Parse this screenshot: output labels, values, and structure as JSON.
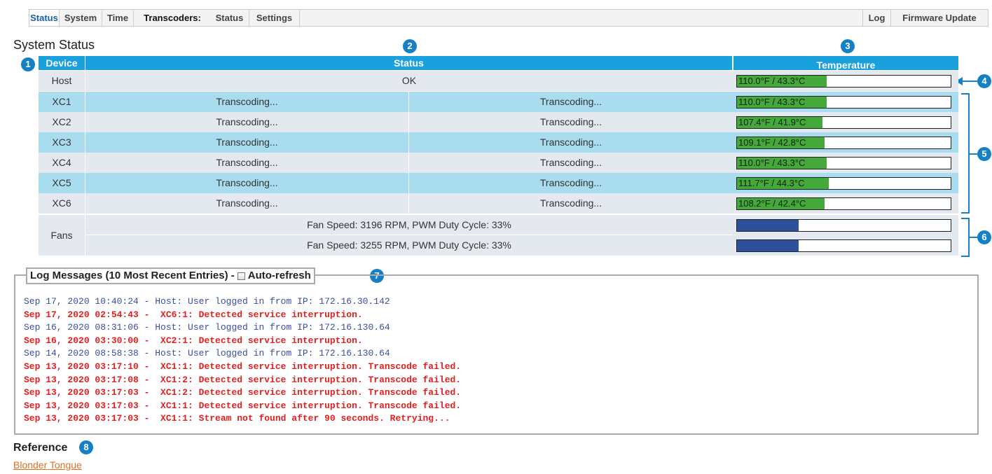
{
  "nav": {
    "items": [
      "Status",
      "System",
      "Time"
    ],
    "section_label": "Transcoders:",
    "sub_items": [
      "Status",
      "Settings"
    ],
    "right_items": [
      "Log",
      "Firmware Update"
    ]
  },
  "title": "System Status",
  "callouts": [
    "1",
    "2",
    "3",
    "4",
    "5",
    "6",
    "7",
    "8"
  ],
  "table": {
    "headers": {
      "device": "Device",
      "status": "Status",
      "temperature": "Temperature"
    },
    "host": {
      "device": "Host",
      "status": "OK",
      "temp": "110.0°F / 43.3°C",
      "temp_fraction": 0.42
    },
    "transcoders": [
      {
        "device": "XC1",
        "status_a": "Transcoding...",
        "status_b": "Transcoding...",
        "temp": "110.0°F / 43.3°C",
        "temp_fraction": 0.42
      },
      {
        "device": "XC2",
        "status_a": "Transcoding...",
        "status_b": "Transcoding...",
        "temp": "107.4°F / 41.9°C",
        "temp_fraction": 0.4
      },
      {
        "device": "XC3",
        "status_a": "Transcoding...",
        "status_b": "Transcoding...",
        "temp": "109.1°F / 42.8°C",
        "temp_fraction": 0.41
      },
      {
        "device": "XC4",
        "status_a": "Transcoding...",
        "status_b": "Transcoding...",
        "temp": "110.0°F / 43.3°C",
        "temp_fraction": 0.42
      },
      {
        "device": "XC5",
        "status_a": "Transcoding...",
        "status_b": "Transcoding...",
        "temp": "111.7°F / 44.3°C",
        "temp_fraction": 0.43
      },
      {
        "device": "XC6",
        "status_a": "Transcoding...",
        "status_b": "Transcoding...",
        "temp": "108.2°F / 42.4°C",
        "temp_fraction": 0.41
      }
    ],
    "fans": {
      "device": "Fans",
      "rows": [
        {
          "status": "Fan Speed: 3196 RPM, PWM Duty Cycle: 33%",
          "duty_fraction": 0.29
        },
        {
          "status": "Fan Speed: 3255 RPM, PWM Duty Cycle: 33%",
          "duty_fraction": 0.29
        }
      ]
    }
  },
  "log": {
    "title": "Log Messages (10 Most Recent Entries) -",
    "autorefresh_label": "Auto-refresh",
    "autorefresh_checked": false,
    "entries": [
      {
        "text": "Sep 17, 2020 10:40:24 - Host: User logged in from IP: 172.16.30.142",
        "level": "info"
      },
      {
        "text": "Sep 17, 2020 02:54:43 -  XC6:1: Detected service interruption.",
        "level": "error"
      },
      {
        "text": "Sep 16, 2020 08:31:06 - Host: User logged in from IP: 172.16.130.64",
        "level": "info"
      },
      {
        "text": "Sep 16, 2020 03:30:00 -  XC2:1: Detected service interruption.",
        "level": "error"
      },
      {
        "text": "Sep 14, 2020 08:58:38 - Host: User logged in from IP: 172.16.130.64",
        "level": "info"
      },
      {
        "text": "Sep 13, 2020 03:17:10 -  XC1:1: Detected service interruption. Transcode failed.",
        "level": "error"
      },
      {
        "text": "Sep 13, 2020 03:17:08 -  XC1:2: Detected service interruption. Transcode failed.",
        "level": "error"
      },
      {
        "text": "Sep 13, 2020 03:17:03 -  XC1:2: Detected service interruption. Transcode failed.",
        "level": "error"
      },
      {
        "text": "Sep 13, 2020 03:17:03 -  XC1:1: Detected service interruption. Transcode failed.",
        "level": "error"
      },
      {
        "text": "Sep 13, 2020 03:17:03 -  XC1:1: Stream not found after 90 seconds. Retrying...",
        "level": "error"
      }
    ]
  },
  "reference": {
    "title": "Reference",
    "link": "Blonder Tongue"
  },
  "colors": {
    "header_blue": "#1aa0dc",
    "row_blue": "#a9dcee",
    "row_light": "#e3e9ef",
    "temp_green": "#44a93a",
    "fan_blue": "#2e4f9c",
    "callout_blue": "#1680c4",
    "log_info": "#3b4da0",
    "log_error": "#e01f1f",
    "link_orange": "#e07020"
  }
}
